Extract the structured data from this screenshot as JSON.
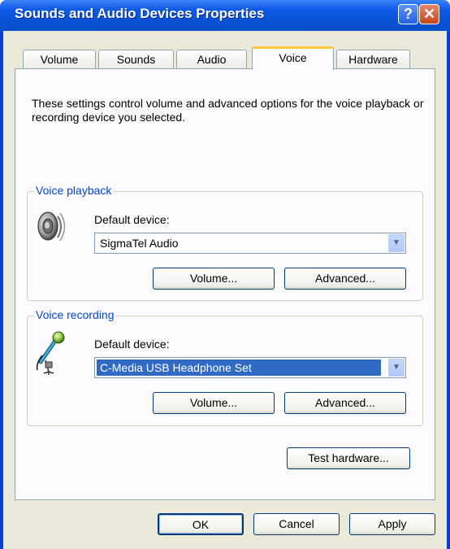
{
  "window": {
    "title": "Sounds and Audio Devices Properties",
    "help_glyph": "?",
    "close_glyph": "✕"
  },
  "tabs": [
    {
      "label": "Volume"
    },
    {
      "label": "Sounds"
    },
    {
      "label": "Audio"
    },
    {
      "label": "Voice",
      "active": true
    },
    {
      "label": "Hardware"
    }
  ],
  "voice": {
    "description": "These settings control volume and advanced options for the voice playback or recording device you selected.",
    "playback": {
      "group_label": "Voice playback",
      "default_device_label": "Default device:",
      "device": "SigmaTel Audio",
      "volume_button": "Volume...",
      "advanced_button": "Advanced...",
      "icon": "speaker-icon"
    },
    "recording": {
      "group_label": "Voice recording",
      "default_device_label": "Default device:",
      "device": "C-Media USB Headphone Set",
      "volume_button": "Volume...",
      "advanced_button": "Advanced...",
      "icon": "microphone-icon"
    },
    "test_hardware_button": "Test hardware..."
  },
  "footer": {
    "ok": "OK",
    "cancel": "Cancel",
    "apply": "Apply"
  },
  "colors": {
    "titlebar": "#0a53d6",
    "group_label": "#0046d5",
    "selection": "#316ac5",
    "tab_highlight": "#ffc73c"
  }
}
